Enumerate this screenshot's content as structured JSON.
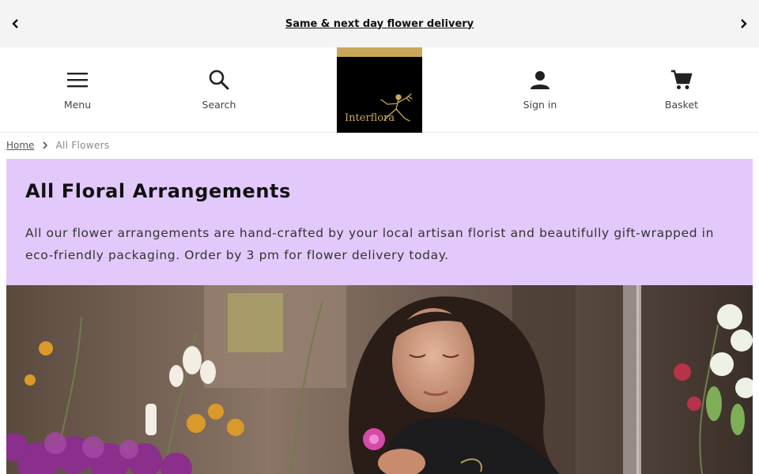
{
  "promo": {
    "text": "Same & next day flower delivery",
    "prev_icon": "chevron-left-icon",
    "next_icon": "chevron-right-icon"
  },
  "header": {
    "nav_left": [
      {
        "label": "Menu",
        "icon": "hamburger-menu-icon"
      },
      {
        "label": "Search",
        "icon": "search-icon"
      }
    ],
    "nav_right": [
      {
        "label": "Sign in",
        "icon": "user-icon"
      },
      {
        "label": "Basket",
        "icon": "cart-icon"
      }
    ],
    "logo": {
      "wordmark": "Interflora",
      "icon": "mercury-logo-icon",
      "accent_color": "#c9a75a",
      "bg_color": "#000000"
    }
  },
  "breadcrumb": {
    "home": "Home",
    "separator_icon": "chevron-right-icon",
    "current": "All Flowers"
  },
  "hero": {
    "title": "All Floral Arrangements",
    "description": "All our flower arrangements are hand-crafted by your local artisan florist and beautifully gift-wrapped in eco-friendly packaging. Order by 3 pm for flower delivery today.",
    "panel_color": "#e3c9fb",
    "image": "florist-arranging-flowers-photo"
  }
}
